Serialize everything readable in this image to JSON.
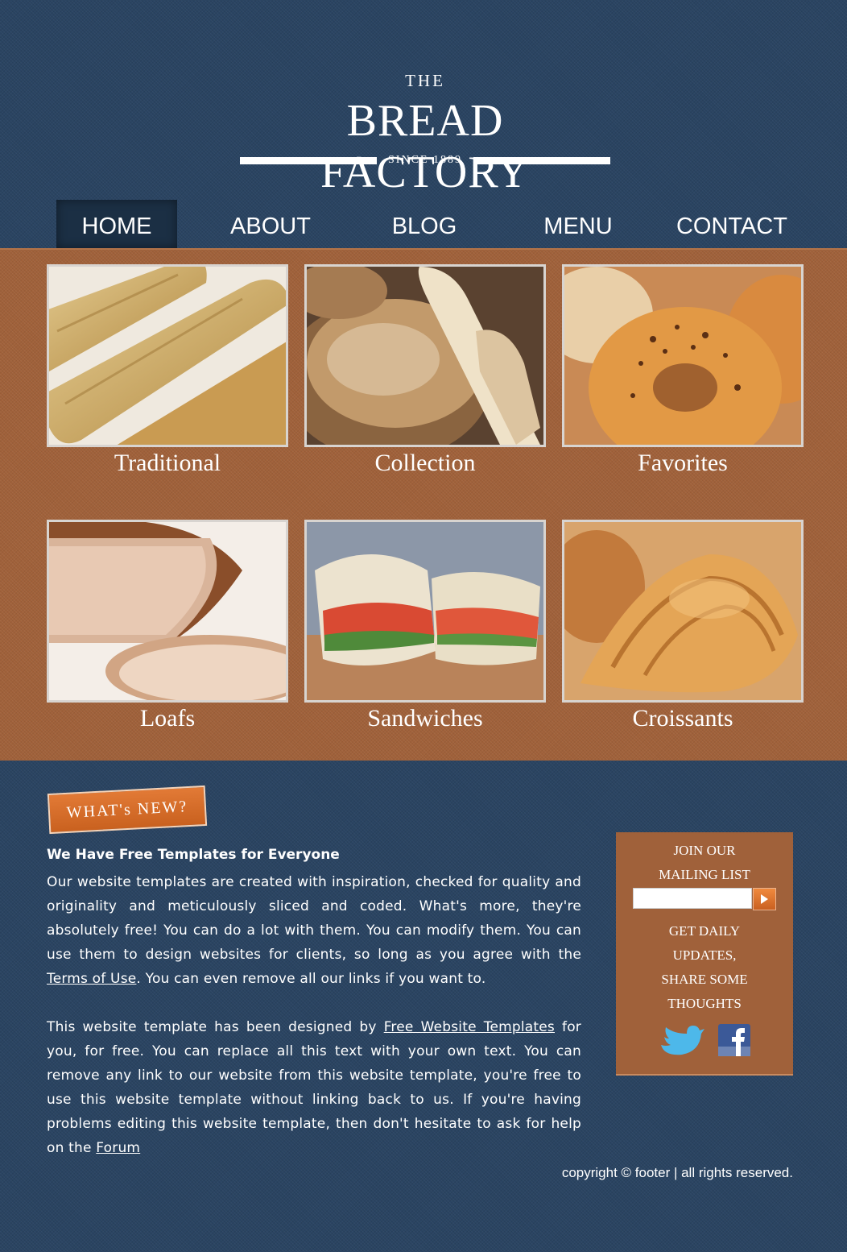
{
  "logo": {
    "the": "THE",
    "name": "BREAD FACTORY",
    "since": "SINCE 1889"
  },
  "nav": {
    "items": [
      "HOME",
      "ABOUT",
      "BLOG",
      "MENU",
      "CONTACT"
    ],
    "active": "HOME"
  },
  "gallery": {
    "tiles": [
      {
        "caption": "Traditional",
        "image": "baguettes-photo"
      },
      {
        "caption": "Collection",
        "image": "assorted-bread-photo"
      },
      {
        "caption": "Favorites",
        "image": "bagels-photo"
      },
      {
        "caption": "Loafs",
        "image": "sliced-loaf-photo"
      },
      {
        "caption": "Sandwiches",
        "image": "sandwich-photo"
      },
      {
        "caption": "Croissants",
        "image": "croissant-photo"
      }
    ]
  },
  "whats_new": {
    "badge": "WHAT's NEW?",
    "heading": "We Have Free Templates for Everyone",
    "p1_text": "Our website templates are created with inspiration, checked for quality and originality and meticulously sliced and coded. What's more, they're absolutely free! You can do a lot with them. You can modify them. You can use them to design websites for clients, so long as you agree with the ",
    "p1_link": "Terms of Use",
    "p1_after": ". You can even remove all our links if you want to.",
    "p2_text": "This website template has been designed by ",
    "p2_link": "Free Website Templates",
    "p2_mid": " for you, for free. You can replace all this text with your own text. You can remove any link to our website from this website template, you're free to use this website template without linking back to us. If you're having problems editing this website template, then don't hesitate to ask for help on the ",
    "p2_link2": "Forum"
  },
  "mailing": {
    "title_line1": "JOIN OUR",
    "title_line2": "MAILING LIST",
    "input_value": "",
    "updates_line1": "GET DAILY",
    "updates_line2": "UPDATES,",
    "updates_line3": "SHARE SOME",
    "updates_line4": "THOUGHTS",
    "social": [
      "twitter-icon",
      "facebook-icon"
    ]
  },
  "footer": {
    "copyright": "copyright © footer | all rights reserved."
  },
  "colors": {
    "background": "#2a4462",
    "gallery": "#a0613a",
    "badge": "#d96e2c",
    "active_nav": "#1b2f44"
  }
}
